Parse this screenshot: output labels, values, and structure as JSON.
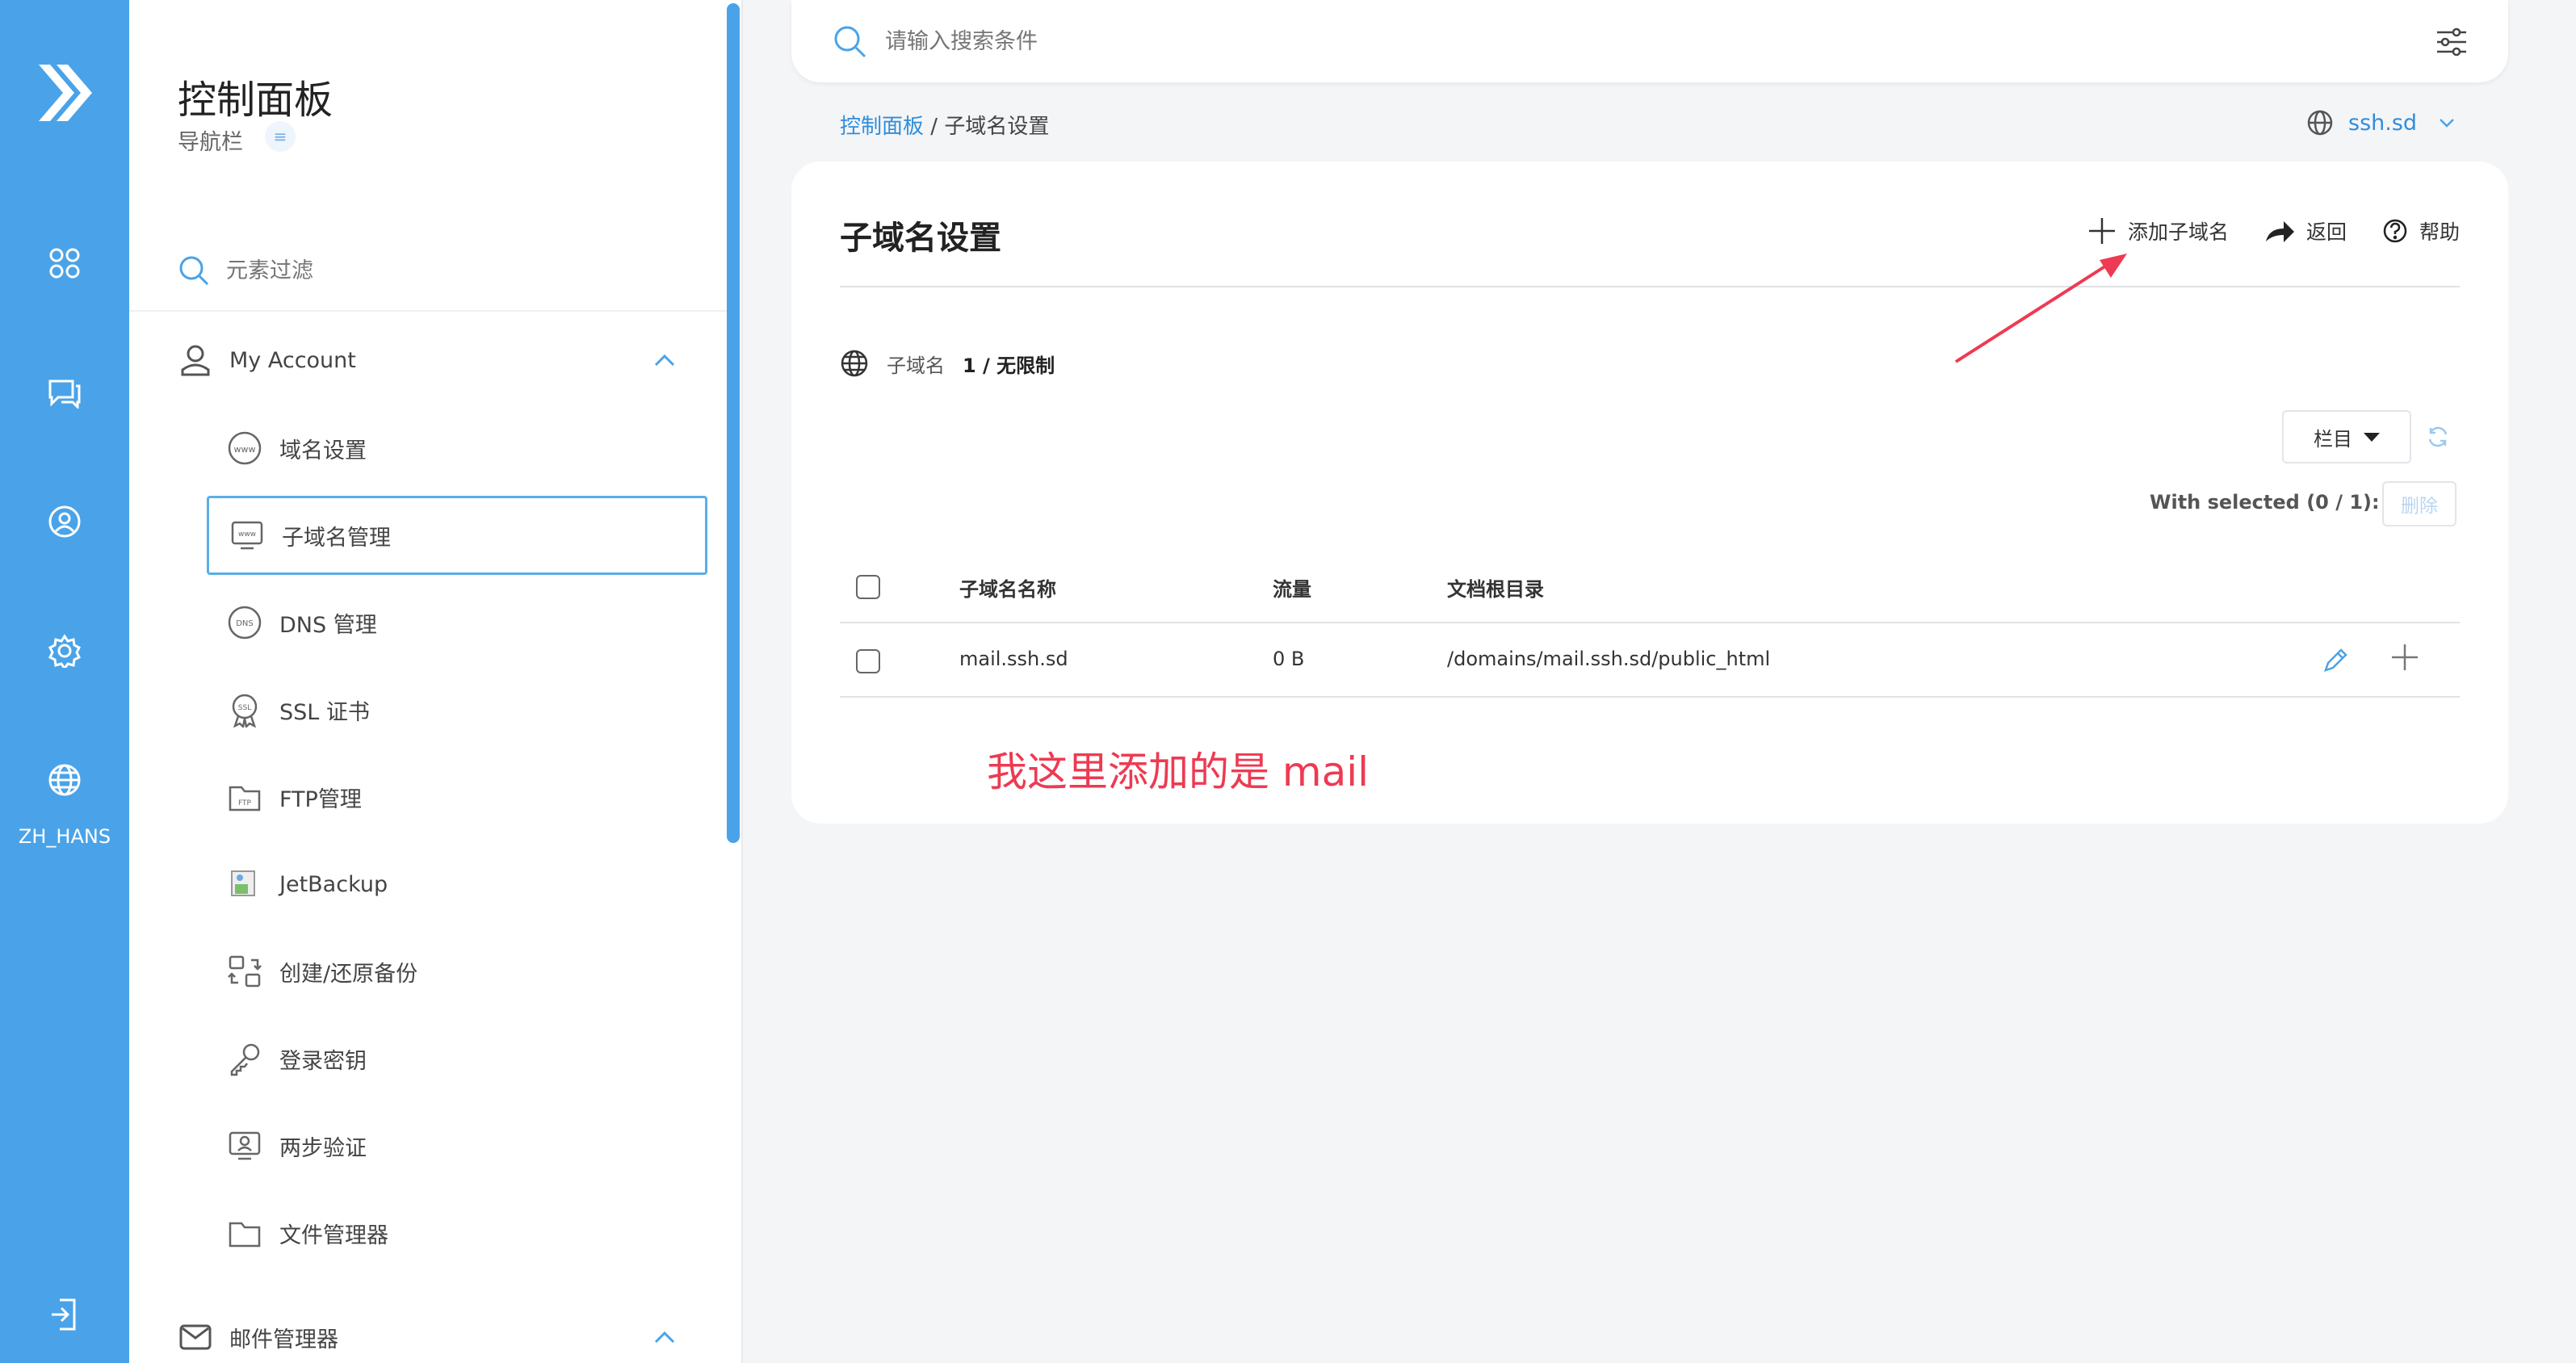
{
  "rail": {
    "lang_label": "ZH_HANS",
    "icons": [
      "dashboard-icon",
      "chat-icon",
      "account-icon",
      "settings-icon",
      "globe-icon",
      "logout-icon"
    ],
    "color": "#4aa3e8"
  },
  "nav": {
    "title": "控制面板",
    "subtitle": "导航栏",
    "filter_placeholder": "元素过滤",
    "groups": [
      {
        "label": "My Account",
        "icon": "user-icon"
      },
      {
        "label": "邮件管理器",
        "icon": "mail-icon"
      }
    ],
    "items": [
      {
        "label": "域名设置",
        "icon": "www-icon"
      },
      {
        "label": "子域名管理",
        "icon": "monitor-www-icon",
        "active": true
      },
      {
        "label": "DNS 管理",
        "icon": "dns-icon"
      },
      {
        "label": "SSL 证书",
        "icon": "ssl-badge-icon"
      },
      {
        "label": "FTP管理",
        "icon": "ftp-folder-icon"
      },
      {
        "label": "JetBackup",
        "icon": "broken-image-icon"
      },
      {
        "label": "创建/还原备份",
        "icon": "backup-icon"
      },
      {
        "label": "登录密钥",
        "icon": "key-icon"
      },
      {
        "label": "两步验证",
        "icon": "two-factor-icon"
      },
      {
        "label": "文件管理器",
        "icon": "folder-icon"
      }
    ]
  },
  "search": {
    "placeholder": "请输入搜索条件"
  },
  "breadcrumb": {
    "root": "控制面板",
    "separator": " / ",
    "current": "子域名设置"
  },
  "domain_select": {
    "value": "ssh.sd"
  },
  "card": {
    "heading": "子域名设置",
    "actions": {
      "add": "添加子域名",
      "back": "返回",
      "help": "帮助"
    },
    "stat": {
      "label": "子域名",
      "value": "1 / 无限制"
    },
    "columns_button": "栏目",
    "with_selected": "With selected (0 / 1):",
    "delete_button": "删除",
    "table": {
      "headers": [
        "子域名名称",
        "流量",
        "文档根目录"
      ],
      "rows": [
        {
          "name": "mail.ssh.sd",
          "traffic": "0 B",
          "docroot": "/domains/mail.ssh.sd/public_html"
        }
      ]
    }
  },
  "annotation": {
    "text": "我这里添加的是 mail",
    "color": "#ee3a52"
  }
}
